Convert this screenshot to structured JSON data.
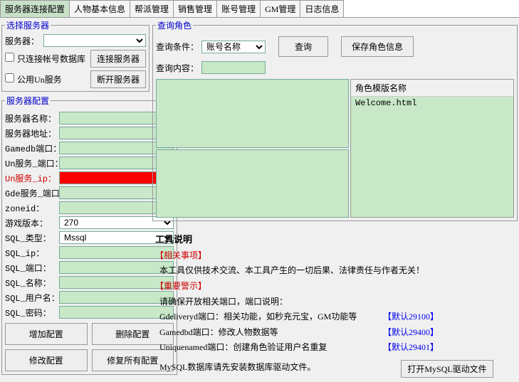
{
  "tabs": [
    "服务器连接配置",
    "人物基本信息",
    "帮派管理",
    "销售管理",
    "账号管理",
    "GM管理",
    "日志信息"
  ],
  "activeTab": 0,
  "serverSelect": {
    "legend": "选择服务器",
    "serverLabel": "服务器：",
    "chkDbOnly": "只连接帐号数据库",
    "btnConnect": "连接服务器",
    "chkPublicUn": "公用Un服务",
    "btnDisconnect": "断开服务器"
  },
  "serverConfig": {
    "legend": "服务器配置",
    "fields": {
      "name": "服务器名称：",
      "addr": "服务器地址：",
      "gamedb": "Gamedb端口：",
      "unport": "Un服务_端口：",
      "unip": "Un服务_ip：",
      "gde": "Gde服务_端口：",
      "zoneid": "zoneid：",
      "gamever": "游戏版本：",
      "sqltype": "SQL_类型：",
      "sqlip": "SQL_ip：",
      "sqlport": "SQL_端口：",
      "sqlname": "SQL_名称：",
      "sqluser": "SQL_用户名：",
      "sqlpwd": "SQL_密码："
    },
    "values": {
      "gamever": "270",
      "sqltype": "Mssql"
    },
    "buttons": {
      "add": "增加配置",
      "del": "删除配置",
      "mod": "修改配置",
      "fix": "修复所有配置"
    }
  },
  "query": {
    "legend": "查询角色",
    "condLabel": "查询条件：",
    "condValue": "账号名称",
    "contentLabel": "查询内容：",
    "btnQuery": "查询",
    "btnSave": "保存角色信息"
  },
  "table": {
    "header": "角色模版名称",
    "rows": [
      "Welcome.html"
    ]
  },
  "desc": {
    "title": "工具说明",
    "related": "【相关事项】",
    "line1": "  本工具仅供技术交流、本工具产生的一切后果、法律责任与作者无关！",
    "warn": "【重要警示】",
    "line2": "  请确保开放相关端口，端口说明：",
    "gd": "  Gdeliveryd端口：相关功能，如秒充元宝，GM功能等",
    "gdport": "【默认29100】",
    "gamedbd": "  Gamedbd端口：修改人物数据等",
    "gamedbdport": "【默认29400】",
    "un": "  Uniquenamed端口：创建角色验证用户名重复",
    "unport": "【默认29401】",
    "mysql": "  MySQL数据库请先安装数据库驱动文件。",
    "btnOpen": "打开MySQL驱动文件"
  }
}
